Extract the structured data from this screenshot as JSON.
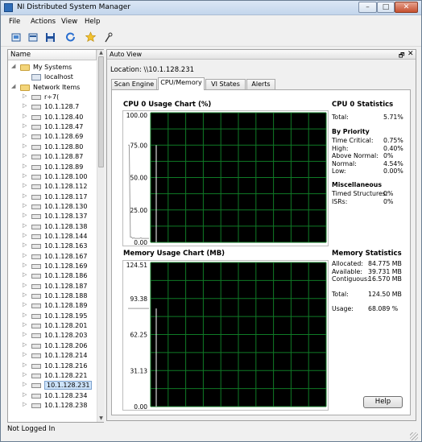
{
  "window": {
    "title": "NI Distributed System Manager"
  },
  "menu": [
    "File",
    "Actions",
    "View",
    "Help"
  ],
  "toolbar": [
    "new-system-icon",
    "new-item-icon",
    "save-icon",
    "refresh-icon",
    "star-icon",
    "probe-icon"
  ],
  "tree": {
    "header": "Name",
    "items": [
      {
        "label": "My Systems",
        "icon": "folder-icon",
        "level": 0,
        "twisty": "◢"
      },
      {
        "label": "localhost",
        "icon": "computer-icon",
        "level": 1,
        "twisty": ""
      },
      {
        "label": "Network Items",
        "icon": "folder-icon",
        "level": 0,
        "twisty": "◢"
      },
      {
        "label": "r÷7(",
        "icon": "device-icon",
        "level": 1,
        "twisty": "▷"
      },
      {
        "label": "10.1.128.7",
        "icon": "device-icon",
        "level": 1,
        "twisty": "▷"
      },
      {
        "label": "10.1.128.40",
        "icon": "device-icon",
        "level": 1,
        "twisty": "▷"
      },
      {
        "label": "10.1.128.47",
        "icon": "device-icon",
        "level": 1,
        "twisty": "▷"
      },
      {
        "label": "10.1.128.69",
        "icon": "device-icon",
        "level": 1,
        "twisty": "▷"
      },
      {
        "label": "10.1.128.80",
        "icon": "device-icon",
        "level": 1,
        "twisty": "▷"
      },
      {
        "label": "10.1.128.87",
        "icon": "device-icon",
        "level": 1,
        "twisty": "▷"
      },
      {
        "label": "10.1.128.89",
        "icon": "device-icon",
        "level": 1,
        "twisty": "▷"
      },
      {
        "label": "10.1.128.100",
        "icon": "device-icon",
        "level": 1,
        "twisty": "▷"
      },
      {
        "label": "10.1.128.112",
        "icon": "device-icon",
        "level": 1,
        "twisty": "▷"
      },
      {
        "label": "10.1.128.117",
        "icon": "device-icon",
        "level": 1,
        "twisty": "▷"
      },
      {
        "label": "10.1.128.130",
        "icon": "device-icon",
        "level": 1,
        "twisty": "▷"
      },
      {
        "label": "10.1.128.137",
        "icon": "device-icon",
        "level": 1,
        "twisty": "▷"
      },
      {
        "label": "10.1.128.138",
        "icon": "device-icon",
        "level": 1,
        "twisty": "▷"
      },
      {
        "label": "10.1.128.144",
        "icon": "device-icon",
        "level": 1,
        "twisty": "▷"
      },
      {
        "label": "10.1.128.163",
        "icon": "device-icon",
        "level": 1,
        "twisty": "▷"
      },
      {
        "label": "10.1.128.167",
        "icon": "device-icon",
        "level": 1,
        "twisty": "▷"
      },
      {
        "label": "10.1.128.169",
        "icon": "device-icon",
        "level": 1,
        "twisty": "▷"
      },
      {
        "label": "10.1.128.186",
        "icon": "device-icon",
        "level": 1,
        "twisty": "▷"
      },
      {
        "label": "10.1.128.187",
        "icon": "device-icon",
        "level": 1,
        "twisty": "▷"
      },
      {
        "label": "10.1.128.188",
        "icon": "device-icon",
        "level": 1,
        "twisty": "▷"
      },
      {
        "label": "10.1.128.189",
        "icon": "device-icon",
        "level": 1,
        "twisty": "▷"
      },
      {
        "label": "10.1.128.195",
        "icon": "device-icon",
        "level": 1,
        "twisty": "▷"
      },
      {
        "label": "10.1.128.201",
        "icon": "device-icon",
        "level": 1,
        "twisty": "▷"
      },
      {
        "label": "10.1.128.203",
        "icon": "device-icon",
        "level": 1,
        "twisty": "▷"
      },
      {
        "label": "10.1.128.206",
        "icon": "device-icon",
        "level": 1,
        "twisty": "▷"
      },
      {
        "label": "10.1.128.214",
        "icon": "device-icon",
        "level": 1,
        "twisty": "▷"
      },
      {
        "label": "10.1.128.216",
        "icon": "device-icon",
        "level": 1,
        "twisty": "▷"
      },
      {
        "label": "10.1.128.221",
        "icon": "device-icon",
        "level": 1,
        "twisty": "▷"
      },
      {
        "label": "10.1.128.231",
        "icon": "device-icon",
        "level": 1,
        "twisty": "▷",
        "selected": true
      },
      {
        "label": "10.1.128.234",
        "icon": "device-icon",
        "level": 1,
        "twisty": "▷"
      },
      {
        "label": "10.1.128.238",
        "icon": "device-icon",
        "level": 1,
        "twisty": "▷"
      }
    ]
  },
  "auto_view": {
    "title": "Auto View",
    "location": "Location: \\\\10.1.128.231",
    "tabs": [
      "Scan Engine",
      "CPU/Memory",
      "VI States",
      "Alerts"
    ],
    "active_tab": 1
  },
  "cpu_stats": {
    "title": "CPU 0 Statistics",
    "total_label": "Total:",
    "total_value": "5.71%",
    "priority_title": "By Priority",
    "rows": [
      {
        "label": "Time Critical:",
        "value": "0.75%"
      },
      {
        "label": "High:",
        "value": "0.40%"
      },
      {
        "label": "Above Normal:",
        "value": "0%"
      },
      {
        "label": "Normal:",
        "value": "4.54%"
      },
      {
        "label": "Low:",
        "value": "0.00%"
      }
    ],
    "misc_title": "Miscellaneous",
    "misc_rows": [
      {
        "label": "Timed Structures:",
        "value": "0%"
      },
      {
        "label": "ISRs:",
        "value": "0%"
      }
    ]
  },
  "mem_stats": {
    "title": "Memory Statistics",
    "rows": [
      {
        "label": "Allocated:",
        "value": "84.775 MB"
      },
      {
        "label": "Available:",
        "value": "39.731 MB"
      },
      {
        "label": "Contiguous:",
        "value": "16.570 MB"
      }
    ],
    "total_label": "Total:",
    "total_value": "124.50 MB",
    "usage_label": "Usage:",
    "usage_value": "68.089 %"
  },
  "help_label": "Help",
  "status": "Not Logged In",
  "colors": {
    "plot_bg": "#000000",
    "grid": "#0f7a26",
    "trace": "#ffffff"
  },
  "chart_data": [
    {
      "type": "line",
      "title": "CPU 0 Usage Chart (%)",
      "ylim": [
        0,
        100
      ],
      "yticks": [
        "100.00",
        "75.00",
        "50.00",
        "25.00",
        "0.00"
      ],
      "grid": true,
      "series": [
        {
          "values": [
            75,
            75,
            4,
            4,
            3,
            3.5,
            3,
            3,
            3,
            3,
            3,
            3.5,
            3,
            3,
            3,
            3,
            3,
            3,
            3
          ]
        }
      ]
    },
    {
      "type": "line",
      "title": "Memory Usage Chart (MB)",
      "ylim": [
        0,
        124.51
      ],
      "yticks": [
        "124.51",
        "93.38",
        "62.25",
        "31.13",
        "0.00"
      ],
      "grid": true,
      "series": [
        {
          "values": [
            84.775,
            84.775,
            84.775,
            84.775,
            84.775,
            84.775,
            84.775,
            84.775,
            84.775,
            84.775,
            84.775,
            84.775,
            84.775,
            84.775,
            84.775,
            84.775,
            84.775,
            84.775,
            84.775
          ]
        }
      ]
    }
  ]
}
